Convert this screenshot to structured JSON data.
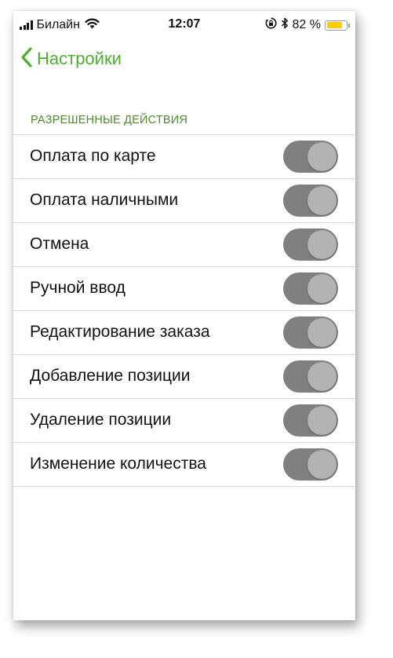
{
  "status_bar": {
    "carrier": "Билайн",
    "time": "12:07",
    "battery_percent": "82 %",
    "battery_level": 0.82,
    "battery_color": "#ffcc00"
  },
  "nav": {
    "back_label": "Настройки",
    "accent_color": "#4caf2e"
  },
  "section": {
    "header": "РАЗРЕШЕННЫЕ ДЕЙСТВИЯ",
    "items": [
      {
        "label": "Оплата по карте",
        "enabled": false
      },
      {
        "label": "Оплата наличными",
        "enabled": false
      },
      {
        "label": "Отмена",
        "enabled": false
      },
      {
        "label": "Ручной ввод",
        "enabled": false
      },
      {
        "label": "Редактирование заказа",
        "enabled": false
      },
      {
        "label": "Добавление позиции",
        "enabled": false
      },
      {
        "label": "Удаление позиции",
        "enabled": false
      },
      {
        "label": "Изменение количества",
        "enabled": false
      }
    ]
  }
}
